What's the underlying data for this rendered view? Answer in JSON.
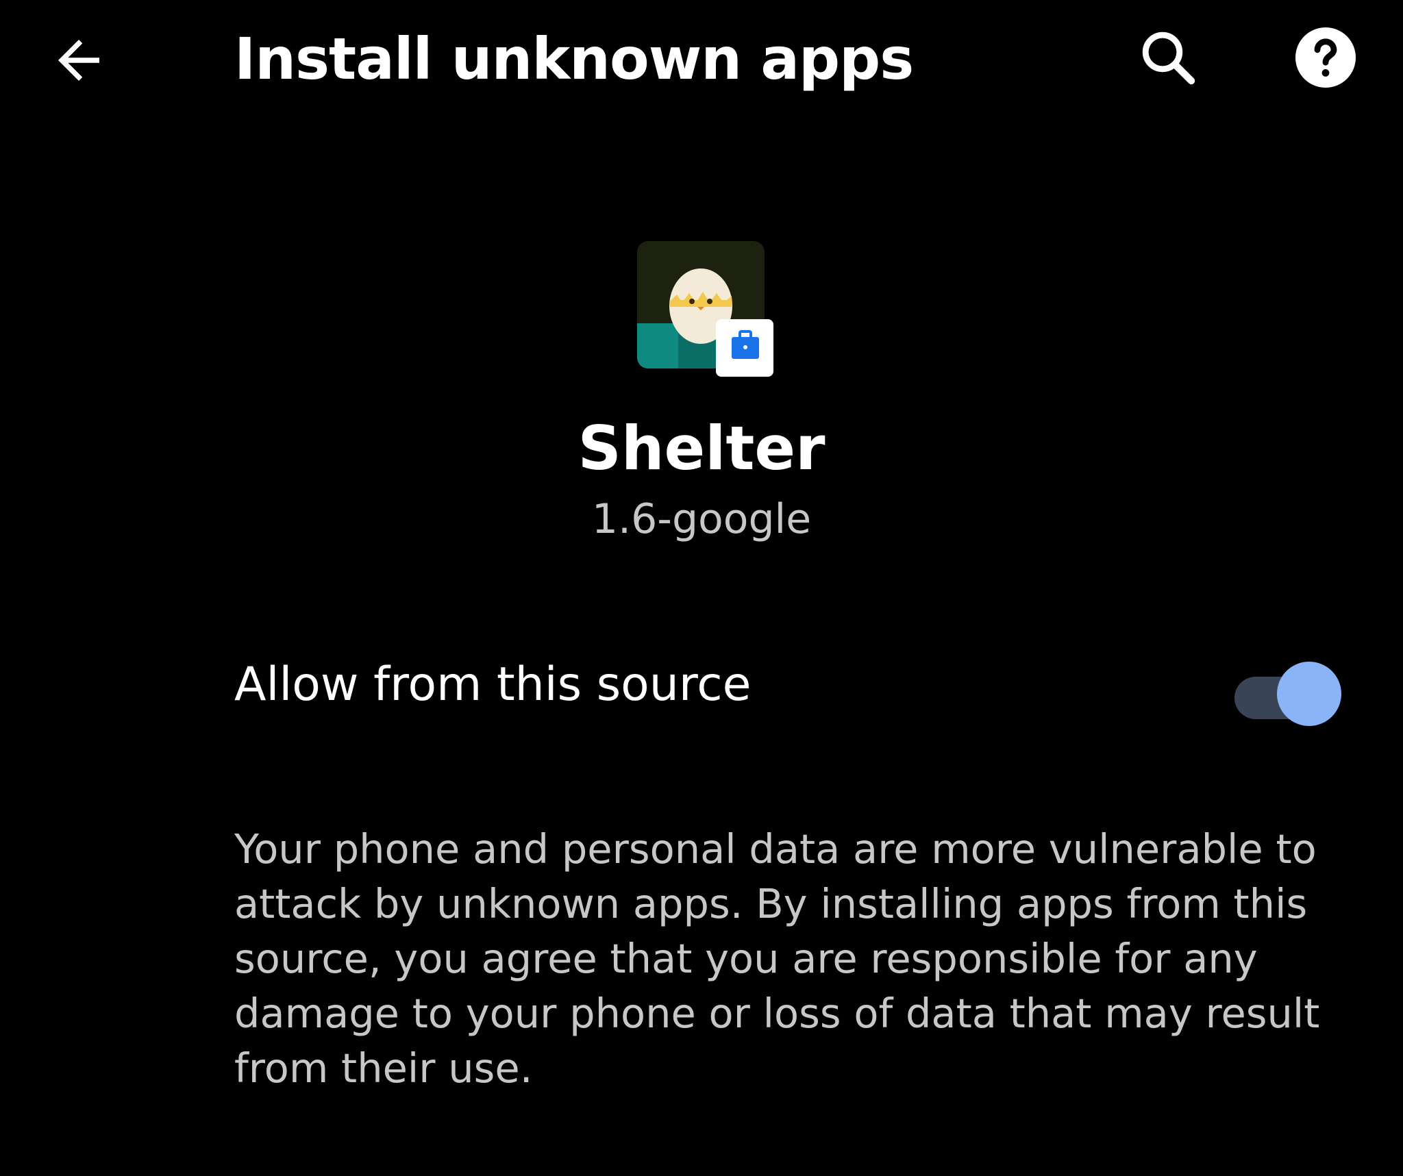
{
  "app_bar": {
    "title": "Install unknown apps",
    "back_icon": "arrow-back-icon",
    "search_icon": "search-icon",
    "help_icon": "help-icon"
  },
  "app": {
    "name": "Shelter",
    "version": "1.6-google",
    "icon": "shelter-app-icon",
    "badge_icon": "work-briefcase-badge-icon"
  },
  "setting": {
    "label": "Allow from this source",
    "enabled": true
  },
  "warning": {
    "text": "Your phone and personal data are more vulnerable to attack by unknown apps. By installing apps from this source, you agree that you are responsible for any damage to your phone or loss of data that may result from their use."
  },
  "colors": {
    "background": "#000000",
    "text_primary": "#ffffff",
    "text_secondary": "#c7c7c7",
    "switch_thumb": "#8ab4f8",
    "switch_track": "#394456",
    "badge_blue": "#1a73e8"
  }
}
